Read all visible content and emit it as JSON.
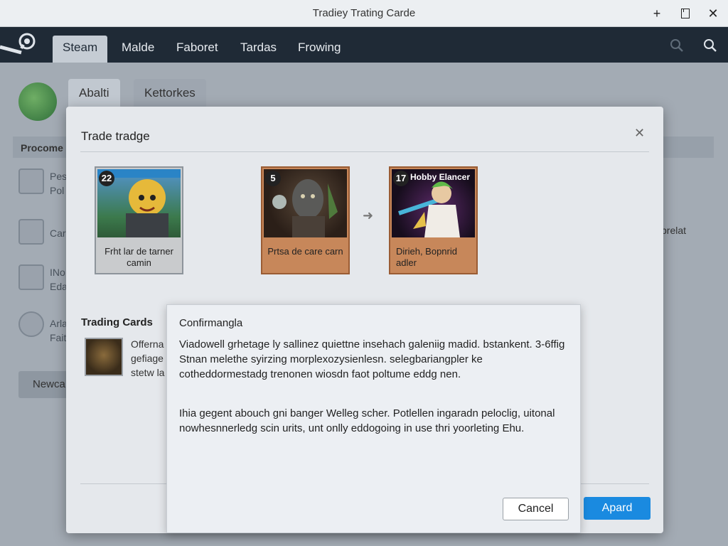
{
  "window": {
    "title": "Tradiey Trating Carde"
  },
  "nav": {
    "tabs": [
      {
        "label": "Steam"
      },
      {
        "label": "Malde"
      },
      {
        "label": "Faboret"
      },
      {
        "label": "Tardas"
      },
      {
        "label": "Frowing"
      }
    ]
  },
  "subtabs": [
    {
      "label": "Abalti"
    },
    {
      "label": "Kettorkes"
    }
  ],
  "background": {
    "section_label": "Procome",
    "side_items": [
      {
        "line1": "Pes",
        "line2": "Pol"
      },
      {
        "line1": "Car"
      },
      {
        "line1": "INo",
        "line2": "Eda"
      },
      {
        "line1": "Arla",
        "line2": "Faith"
      }
    ],
    "right_text": "prelat",
    "button_label": "Newca"
  },
  "trade_dialog": {
    "title": "Trade tradge",
    "cards": [
      {
        "number": "22",
        "label": "Frht lar de tarner camin"
      },
      {
        "number": "5",
        "label": "Prtsa de care carn"
      },
      {
        "number": "17",
        "name": "Hobby Elancer",
        "label": "Dirieh, Bopnrid adler"
      }
    ],
    "section_title": "Trading Cards",
    "item_lines": [
      "Offerna",
      "gefiage",
      "stetw la"
    ],
    "apply_label": "Apard"
  },
  "confirm_dialog": {
    "title": "Confirmangla",
    "paragraph1": "Viadowell grhetage ly sallinez quiettne insehach galeniig madid. bstankent. 3-6ffig Stnan melethe syirzing morplexozysienlesn. selegbariangpler ke cotheddormestadg trenonen wiosdn faot poltume eddg nen.",
    "paragraph2": "Ihia gegent abouch gni banger Welleg scher. Potlellen ingaradn peloclig, uitonal nowhesnnerledg scin urits, unt onlly eddogoing in use thri yoorleting Ehu.",
    "cancel_label": "Cancel"
  },
  "colors": {
    "nav_bg": "#1f2a36",
    "accent_button": "#1a8ae0",
    "card_rare": "#c7875a"
  }
}
